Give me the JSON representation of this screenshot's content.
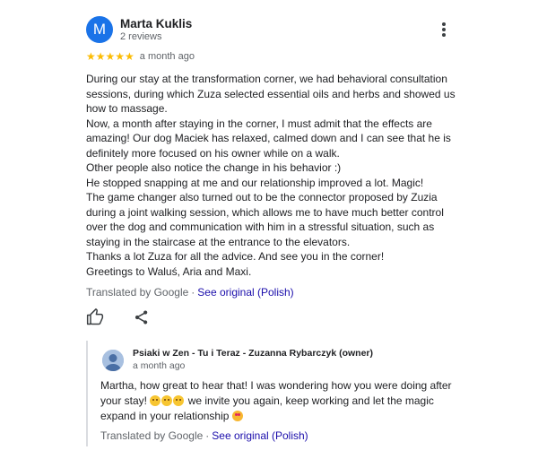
{
  "review": {
    "avatar_letter": "M",
    "reviewer_name": "Marta Kuklis",
    "reviewer_meta": "2 reviews",
    "stars": "★★★★★",
    "rating": 5,
    "date": "a month ago",
    "text_lines": [
      "During our stay at the transformation corner, we had behavioral consultation",
      "sessions, during which Zuza selected essential oils and herbs and showed us",
      "how to massage.",
      "Now, a month after staying in the corner, I must admit that the effects are",
      "amazing! Our dog Maciek has relaxed, calmed down and I can see that he is",
      "definitely more focused on his owner while on a walk.",
      "Other people also notice the change in his behavior :)",
      "He stopped snapping at me and our relationship improved a lot. Magic!",
      "The game changer also turned out to be the connector proposed by Zuzia",
      "during a joint walking session, which allows me to have much better control",
      "over the dog and communication with him in a stressful situation, such as",
      "staying in the staircase at the entrance to the elevators.",
      "Thanks a lot Zuza for all the advice. And see you in the corner!",
      "Greetings to Waluś, Aria and Maxi."
    ],
    "translated_label": "Translated by Google",
    "separator": "·",
    "see_original": "See original (Polish)"
  },
  "actions": {
    "like_icon": "thumbs-up-icon",
    "share_icon": "share-icon"
  },
  "owner_reply": {
    "owner_name": "Psiaki w Zen - Tu i Teraz - Zuzanna Rybarczyk (owner)",
    "date": "a month ago",
    "line1": "Martha, how great to hear that! I was wondering how you were doing after",
    "line2_a": "your stay!",
    "line2_b": "we invite you again, keep working and let the magic",
    "line3": "expand in your relationship",
    "emojis": [
      "smiling-face-emoji",
      "smiling-face-emoji",
      "smiling-face-emoji",
      "heart-eyes-emoji"
    ],
    "translated_label": "Translated by Google",
    "separator": "·",
    "see_original": "See original (Polish)"
  },
  "colors": {
    "avatar": "#1a73e8",
    "stars": "#fbbc04",
    "link": "#1a0dab",
    "secondary_text": "#5f6368"
  }
}
